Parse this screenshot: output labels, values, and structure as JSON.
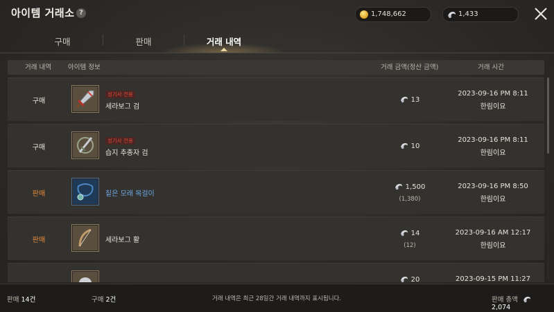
{
  "header": {
    "title": "아이템 거래소",
    "help": "?",
    "gold": "1,748,662",
    "silver": "1,433"
  },
  "tabs": [
    "구매",
    "판매",
    "거래 내역"
  ],
  "active_tab": "거래 내역",
  "columns": {
    "type": "거래 내역",
    "item": "아이템 정보",
    "price": "거래 금액(정산 금액)",
    "time": "거래 시간"
  },
  "rows": [
    {
      "type": "구매",
      "tag": "성기사 전용",
      "name": "세라보그 검",
      "price": "13",
      "settle": "",
      "date": "2023-09-16 PM 8:11",
      "buyer": "한림이요"
    },
    {
      "type": "구매",
      "tag": "성기사 전용",
      "name": "습지 추종자 검",
      "price": "10",
      "settle": "",
      "date": "2023-09-16 PM 8:11",
      "buyer": "한림이요"
    },
    {
      "type": "판매",
      "tag": "",
      "name": "짙은 모래 목걸이",
      "price": "1,500",
      "settle": "(1,380)",
      "date": "2023-09-16 PM 8:50",
      "buyer": "한림이요"
    },
    {
      "type": "판매",
      "tag": "",
      "name": "세라보그 활",
      "price": "14",
      "settle": "(12)",
      "date": "2023-09-16 AM 12:17",
      "buyer": "한림이요"
    },
    {
      "type": "",
      "tag": "",
      "name": "",
      "price": "20",
      "settle": "",
      "date": "2023-09-15 PM 11:27",
      "buyer": ""
    }
  ],
  "footer": {
    "sell_label": "판매",
    "sell_count": "14건",
    "buy_label": "구매",
    "buy_count": "2건",
    "notice": "거래 내역은 최근 28일간 거래 내역까지 표시됩니다.",
    "total_label": "판매 총액",
    "total_value": "2,074"
  },
  "colors": {
    "sell": "#e58a3a",
    "tag": "#e14a3c",
    "blue_item": "#6ea8e6"
  }
}
